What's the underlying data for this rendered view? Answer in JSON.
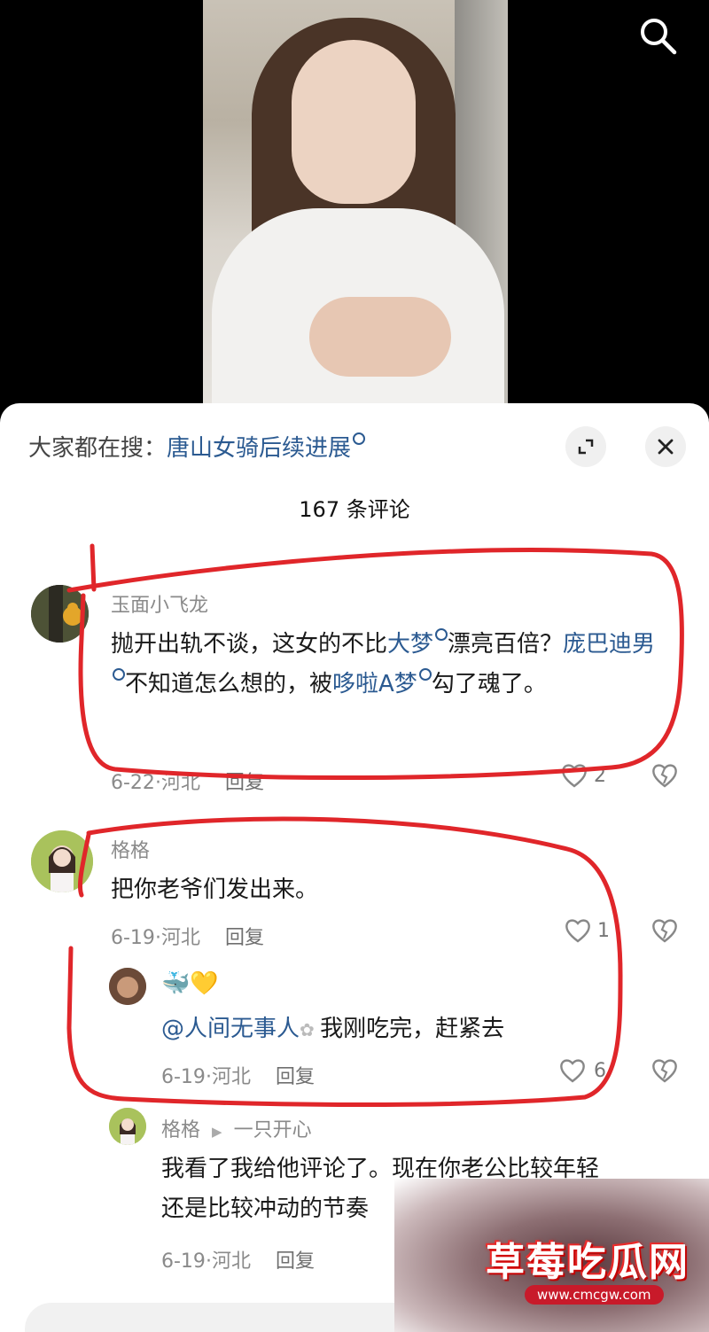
{
  "header": {
    "search_hint_prefix": "大家都在搜：",
    "search_hint_link": "唐山女骑后续进展"
  },
  "comments_count": "167 条评论",
  "comments": [
    {
      "username": "玉面小飞龙",
      "text_parts": [
        "抛开出轨不谈，这女的不比",
        "大梦",
        "漂亮百倍？",
        "庞巴迪男",
        "不知道怎么想的，被",
        "哆啦A梦",
        "勾了魂了。"
      ],
      "date": "6-22",
      "location": "河北",
      "reply_label": "回复",
      "likes": "2"
    },
    {
      "username": "格格",
      "text": "把你老爷们发出来。",
      "date": "6-19",
      "location": "河北",
      "reply_label": "回复",
      "likes": "1"
    }
  ],
  "reply_1": {
    "username_emoji": "🐳💛",
    "mention": "@人间无事人",
    "text": "我刚吃完，赶紧去",
    "date": "6-19",
    "location": "河北",
    "reply_label": "回复",
    "likes": "6"
  },
  "reply_2": {
    "username": "格格",
    "reply_to": "一只开心",
    "text_line1": "我看了我给他评论了。现在你老公比较年轻",
    "text_line2": "还是比较冲动的节奏",
    "date": "6-19",
    "location": "河北",
    "reply_label": "回复"
  },
  "input_placeholder": "",
  "watermark": {
    "title": "草莓吃瓜网",
    "url": "www.cmcgw.com"
  },
  "colors": {
    "link": "#2b5a91",
    "annotation": "#e0262a"
  }
}
